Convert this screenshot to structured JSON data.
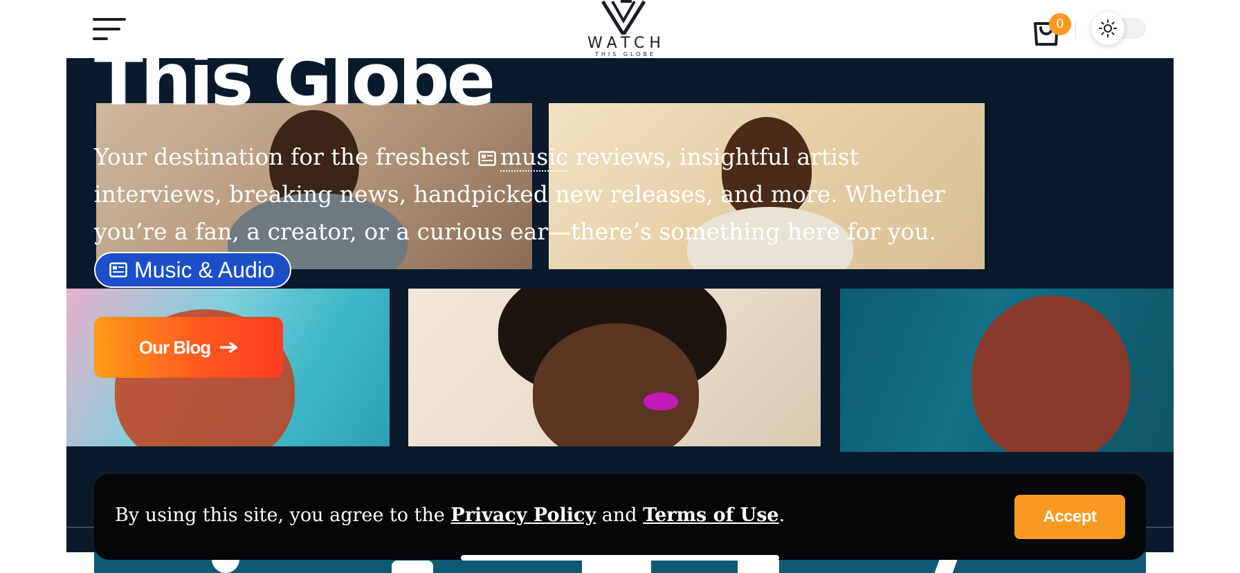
{
  "header": {
    "logo_word": "WATCH",
    "logo_sub": "THIS GLOBE",
    "cart_count": "0",
    "menu_icon": "hamburger-icon",
    "cart_icon": "shopping-bag-icon",
    "theme_icon": "sun-icon"
  },
  "hero": {
    "title": "This Globe",
    "description_before": "Your destination for the freshest ",
    "description_keyword": "music",
    "description_after": " reviews, insightful artist interviews, breaking news, handpicked new releases, and more. Whether you’re a fan, a creator, or a curious ear—there’s something here for you.",
    "tag_label": "Music & Audio",
    "tag_icon": "newspaper-icon",
    "blog_button": "Our Blog",
    "blog_button_icon": "arrow-right-icon"
  },
  "cookie": {
    "text_before": "By using this site, you agree to the ",
    "privacy_link": "Privacy Policy",
    "text_middle": " and ",
    "terms_link": "Terms of Use",
    "text_after": ".",
    "accept_button": "Accept"
  },
  "colors": {
    "accent_orange": "#f79a1f",
    "hero_background": "#0b1a2b",
    "tag_blue": "#1b4fc9",
    "cookie_background": "#050608"
  }
}
